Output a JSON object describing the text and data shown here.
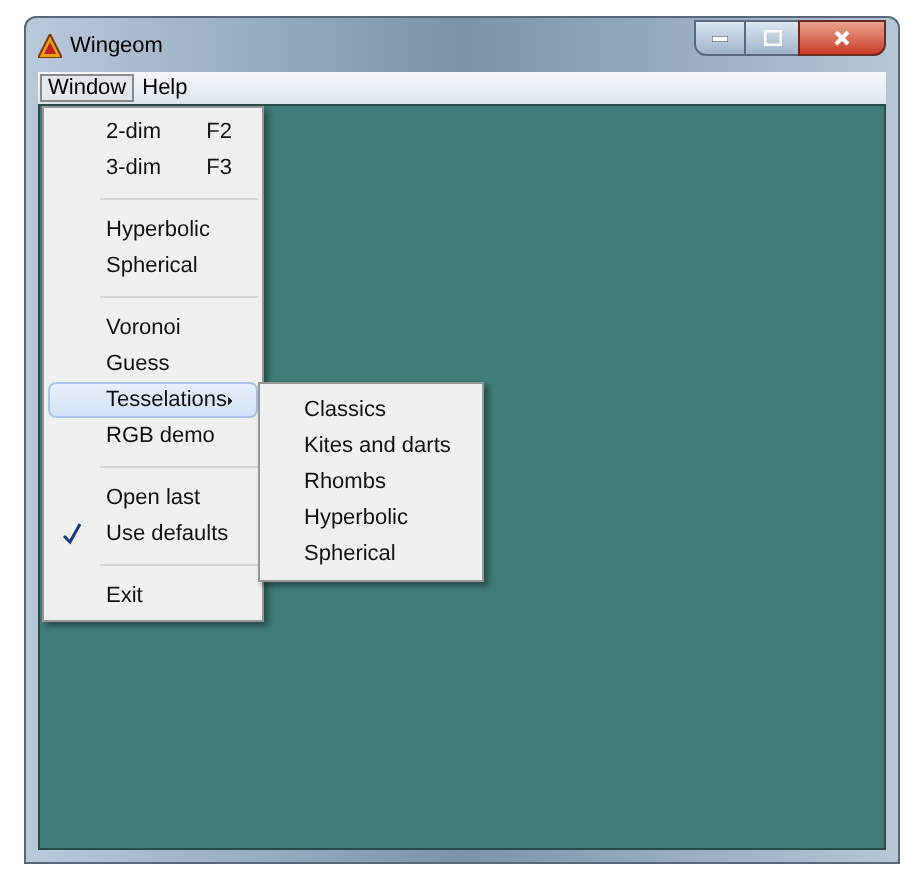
{
  "window": {
    "title": "Wingeom"
  },
  "menubar": [
    {
      "label": "Window",
      "selected": true
    },
    {
      "label": "Help",
      "selected": false
    }
  ],
  "menu": [
    {
      "kind": "item",
      "label": "2-dim",
      "shortcut": "F2",
      "selected": false,
      "checked": false
    },
    {
      "kind": "item",
      "label": "3-dim",
      "shortcut": "F3",
      "selected": false,
      "checked": false
    },
    {
      "kind": "separator"
    },
    {
      "kind": "item",
      "label": "Hyperbolic",
      "selected": false,
      "checked": false
    },
    {
      "kind": "item",
      "label": "Spherical",
      "selected": false,
      "checked": false
    },
    {
      "kind": "separator"
    },
    {
      "kind": "item",
      "label": "Voronoi",
      "selected": false,
      "checked": false
    },
    {
      "kind": "item",
      "label": "Guess",
      "selected": false,
      "checked": false
    },
    {
      "kind": "submenu",
      "label": "Tesselations",
      "selected": true,
      "checked": false
    },
    {
      "kind": "item",
      "label": "RGB demo",
      "selected": false,
      "checked": false
    },
    {
      "kind": "separator"
    },
    {
      "kind": "item",
      "label": "Open last",
      "selected": false,
      "checked": false
    },
    {
      "kind": "item",
      "label": "Use defaults",
      "selected": false,
      "checked": true
    },
    {
      "kind": "separator"
    },
    {
      "kind": "item",
      "label": "Exit",
      "selected": false,
      "checked": false
    }
  ],
  "submenu": [
    "Classics",
    "Kites and darts",
    "Rhombs",
    "Hyperbolic",
    "Spherical"
  ]
}
